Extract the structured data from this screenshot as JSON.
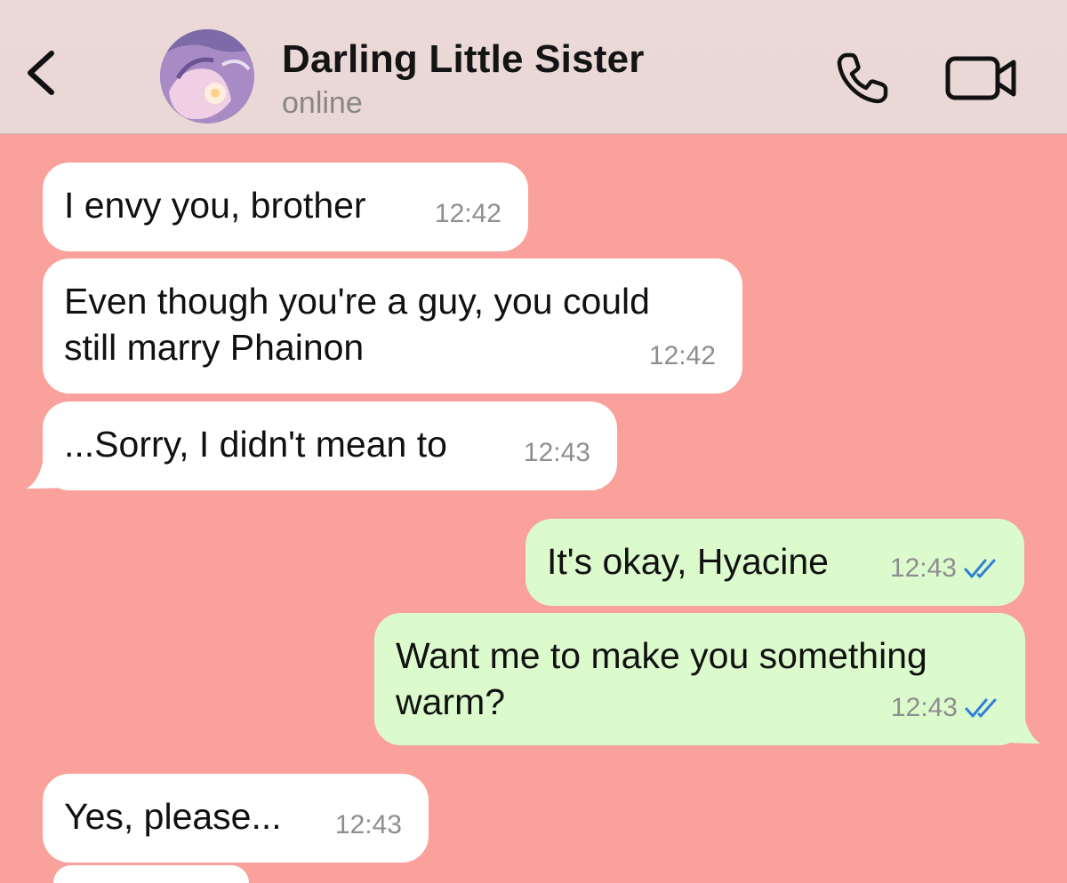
{
  "header": {
    "contact_name": "Darling Little Sister",
    "status": "online",
    "back_icon": "chevron-left-icon",
    "call_icon": "phone-icon",
    "video_icon": "video-camera-icon"
  },
  "messages": [
    {
      "direction": "incoming",
      "text": "I envy you, brother",
      "time": "12:42"
    },
    {
      "direction": "incoming",
      "text": "Even though you're a guy, you could\nstill marry Phainon",
      "time": "12:42"
    },
    {
      "direction": "incoming",
      "text": "...Sorry, I didn't mean to",
      "time": "12:43"
    },
    {
      "direction": "outgoing",
      "text": "It's okay, Hyacine",
      "time": "12:43",
      "status": "read"
    },
    {
      "direction": "outgoing",
      "text": "Want me to make you something\nwarm?",
      "time": "12:43",
      "status": "read"
    },
    {
      "direction": "incoming",
      "text": "Yes, please...",
      "time": "12:43"
    }
  ],
  "colors": {
    "chat_background": "#f9a19a",
    "incoming_bubble": "#ffffff",
    "outgoing_bubble": "#dcfbcd",
    "read_ticks": "#2f7fd8",
    "header_background": "#ead9d7"
  }
}
